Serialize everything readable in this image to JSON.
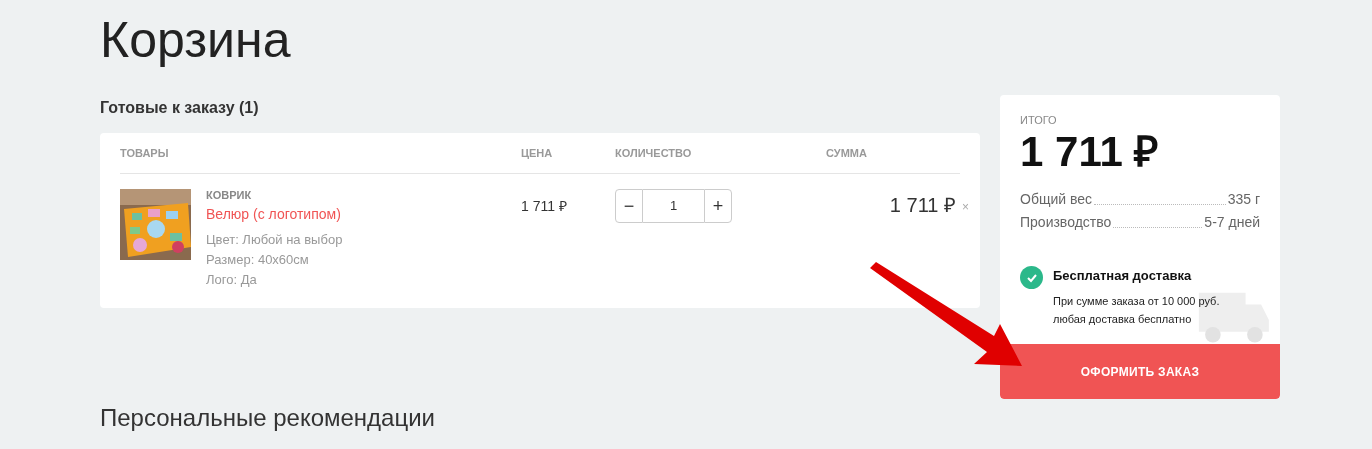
{
  "title": "Корзина",
  "ready_heading": "Готовые к заказу (1)",
  "table": {
    "columns": [
      "ТОВАРЫ",
      "ЦЕНА",
      "КОЛИЧЕСТВО",
      "СУММА"
    ],
    "rows": [
      {
        "category": "КОВРИК",
        "name": "Велюр (с логотипом)",
        "options": [
          "Цвет: Любой на выбор",
          "Размер: 40х60см",
          "Лого: Да"
        ],
        "price": "1 711 ₽",
        "quantity": "1",
        "minus": "−",
        "plus": "+",
        "sum": "1 711 ₽",
        "remove": "×",
        "image": {
          "kind": "picture"
        }
      }
    ]
  },
  "summary": {
    "label": "ИТОГО",
    "total": "1 711 ₽",
    "details": [
      {
        "label": "Общий вес",
        "value": "335 г"
      },
      {
        "label": "Производство",
        "value": "5-7 дней"
      }
    ],
    "delivery": {
      "checked": true,
      "title": "Бесплатная доставка",
      "text": "При сумме заказа от 10 000 руб. любая доставка бесплатно"
    },
    "button": "ОФОРМИТЬ ЗАКАЗ"
  },
  "recommendations_heading": "Персональные рекомендации"
}
